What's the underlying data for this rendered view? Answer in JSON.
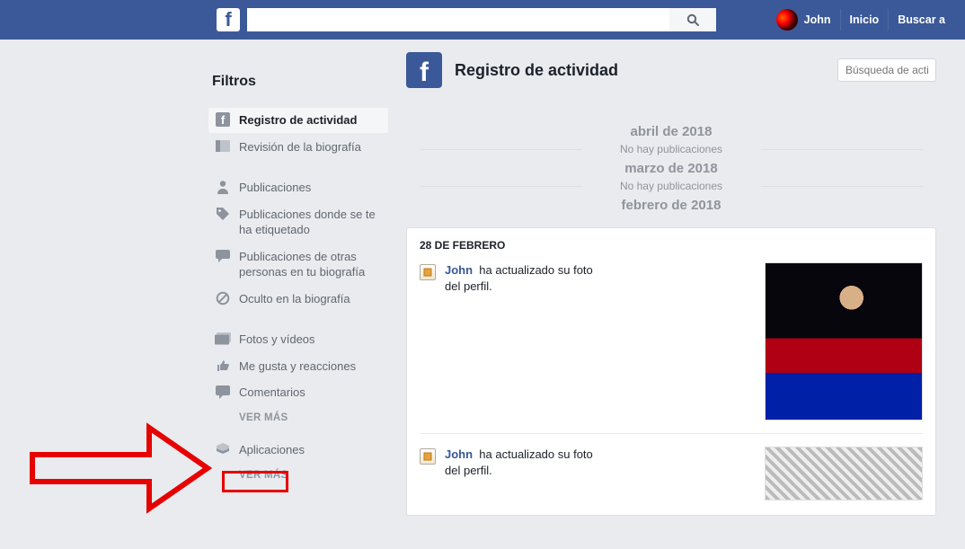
{
  "topnav": {
    "user_name": "John",
    "home": "Inicio",
    "search_friends": "Buscar a",
    "search_placeholder": ""
  },
  "sidebar": {
    "title": "Filtros",
    "section1": [
      {
        "label": "Registro de actividad",
        "icon": "facebook-icon",
        "active": true
      },
      {
        "label": "Revisión de la biografía",
        "icon": "review-icon",
        "active": false
      }
    ],
    "section2": [
      {
        "label": "Publicaciones",
        "icon": "person-icon"
      },
      {
        "label": "Publicaciones donde se te ha etiquetado",
        "icon": "tag-icon"
      },
      {
        "label": "Publicaciones de otras personas en tu biografía",
        "icon": "comment-box-icon"
      },
      {
        "label": "Oculto en la biografía",
        "icon": "hidden-icon"
      }
    ],
    "section3": [
      {
        "label": "Fotos y vídeos",
        "icon": "photos-icon"
      },
      {
        "label": "Me gusta y reacciones",
        "icon": "like-icon"
      },
      {
        "label": "Comentarios",
        "icon": "comment-icon"
      }
    ],
    "more": "VER MÁS",
    "section4": [
      {
        "label": "Aplicaciones",
        "icon": "apps-icon"
      }
    ],
    "more2": "VER MÁS"
  },
  "main": {
    "title": "Registro de actividad",
    "search_placeholder": "Búsqueda de actividad",
    "timeline": [
      {
        "month": "abril de 2018",
        "empty": "No hay publicaciones"
      },
      {
        "month": "marzo de 2018",
        "empty": "No hay publicaciones"
      },
      {
        "month": "febrero de 2018"
      }
    ],
    "card_header": "28 DE FEBRERO",
    "entries": [
      {
        "name": "John",
        "rest": "ha actualizado su foto",
        "line2": "del perfil."
      },
      {
        "name": "John",
        "rest": "ha actualizado su foto",
        "line2": "del perfil."
      }
    ]
  }
}
